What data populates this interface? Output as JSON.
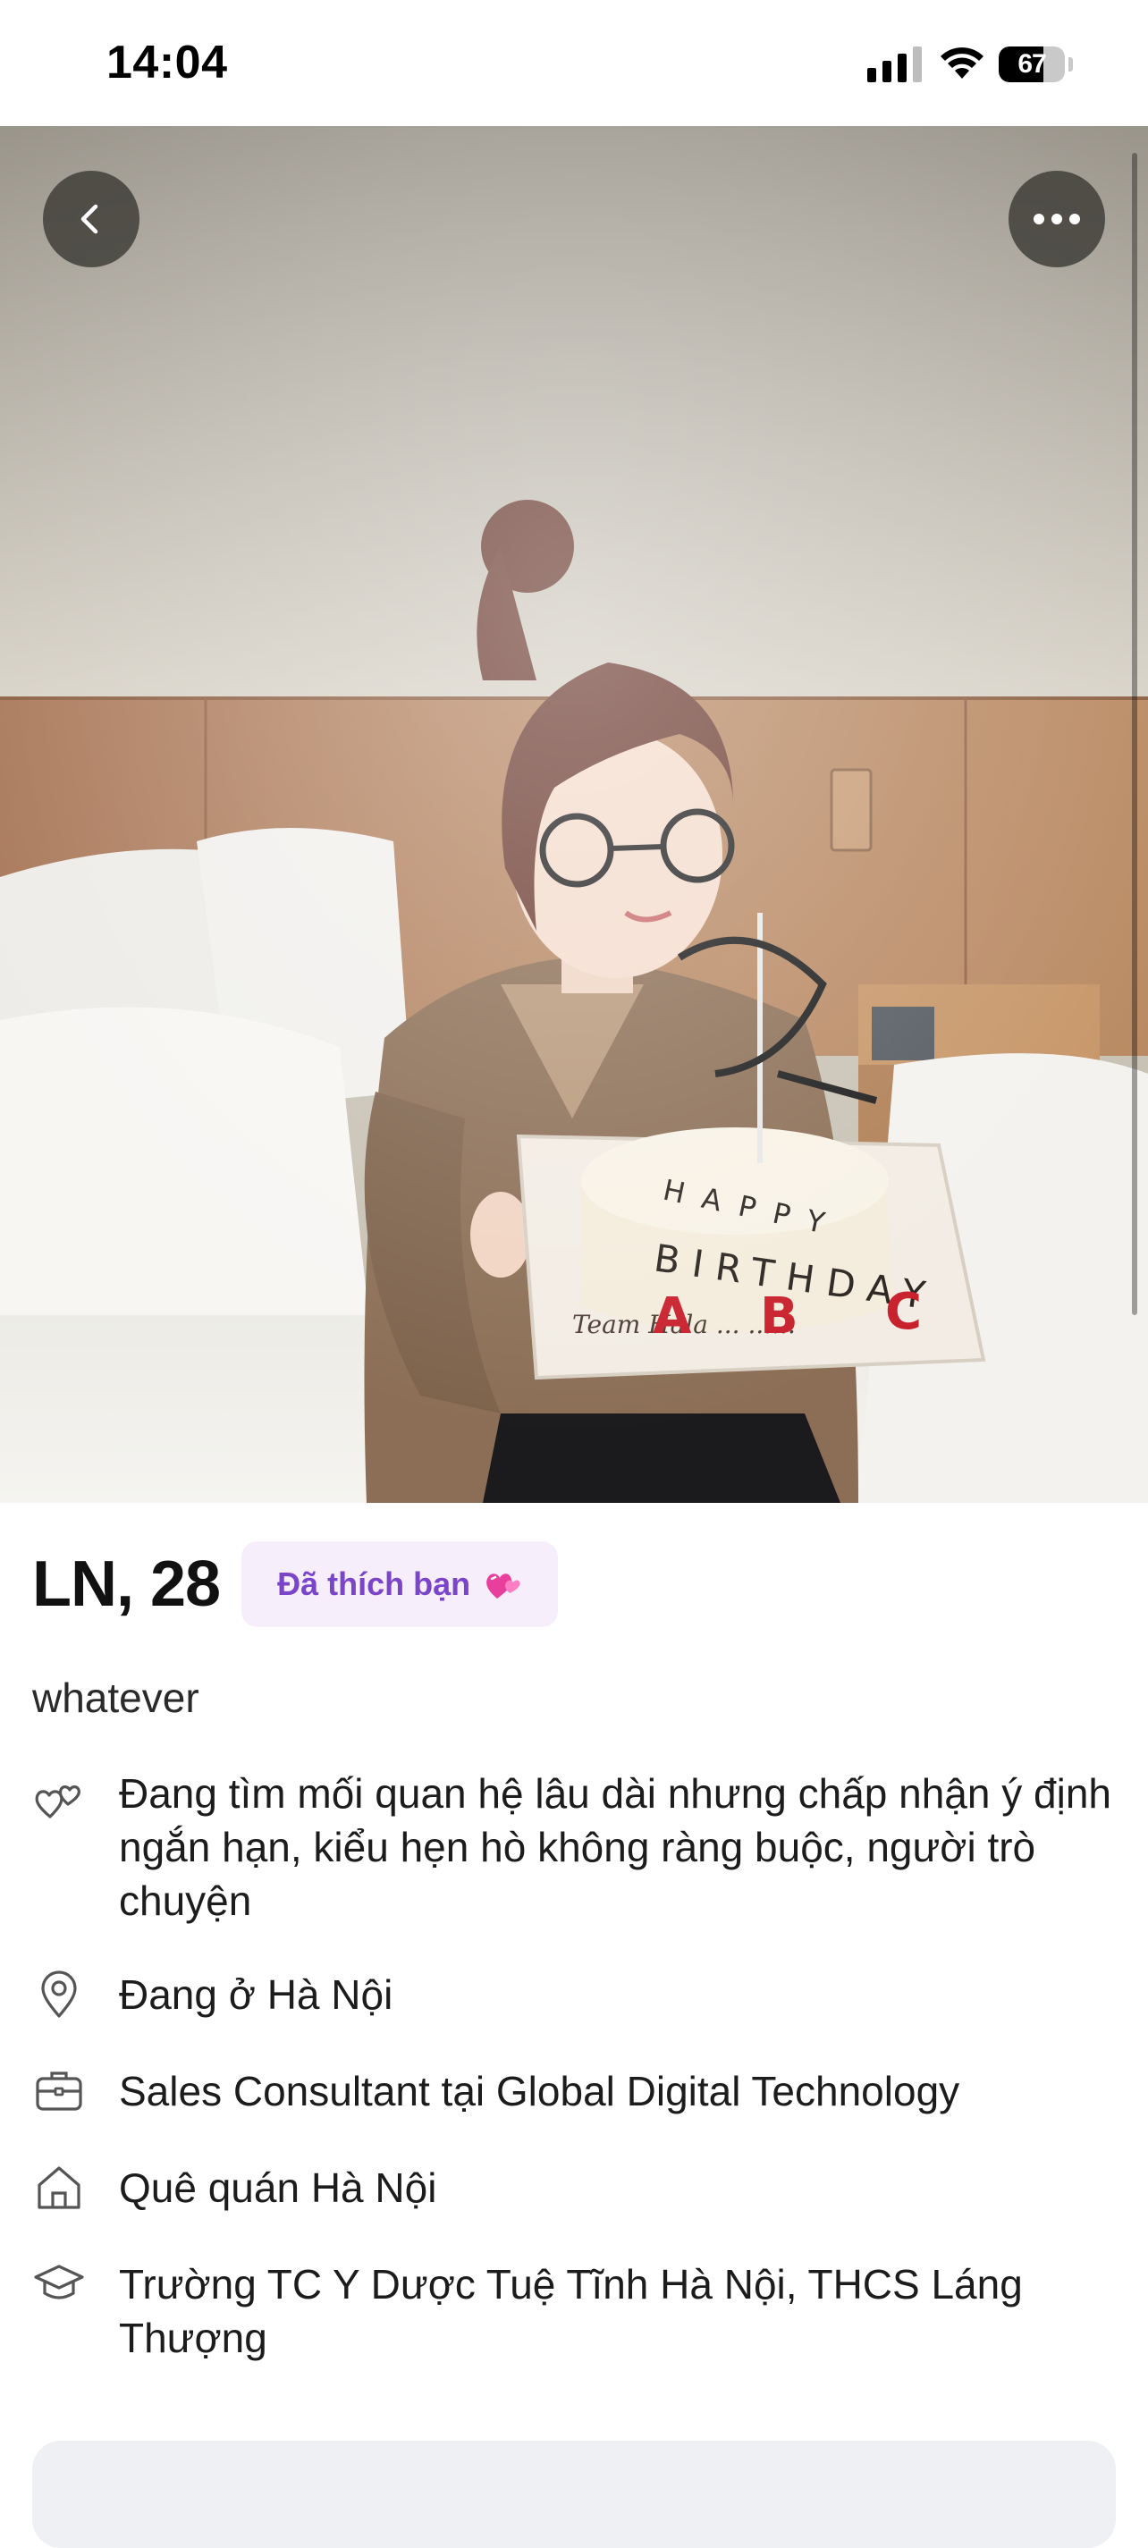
{
  "status_bar": {
    "time": "14:04",
    "battery": "67",
    "battery_level": 0.67,
    "icons": [
      "signal-icon",
      "wifi-icon",
      "battery-icon"
    ]
  },
  "photo_controls": {
    "icons": [
      "back-chevron-icon",
      "more-dots-icon"
    ]
  },
  "profile": {
    "name_age": "LN, 28",
    "liked_badge": "Đã thích bạn",
    "liked_icon": "heart-emoji-icon",
    "bio": "whatever",
    "details": [
      {
        "icon": "hearts-icon",
        "text": "Đang tìm mối quan hệ lâu dài nhưng chấp nhận ý định ngắn hạn, kiểu hẹn hò không ràng buộc, người trò chuyện"
      },
      {
        "icon": "location-pin-icon",
        "text": "Đang ở Hà Nội"
      },
      {
        "icon": "briefcase-icon",
        "text": "Sales Consultant tại Global Digital Technology"
      },
      {
        "icon": "home-icon",
        "text": "Quê quán Hà Nội"
      },
      {
        "icon": "graduation-cap-icon",
        "text": "Trường TC Y Dược Tuệ Tĩnh Hà Nội, THCS Láng Thượng"
      }
    ]
  },
  "colors": {
    "badge_bg": "#f6eefb",
    "badge_text": "#7a45c9",
    "text": "#1c1c1c",
    "icon_stroke": "#555555"
  }
}
